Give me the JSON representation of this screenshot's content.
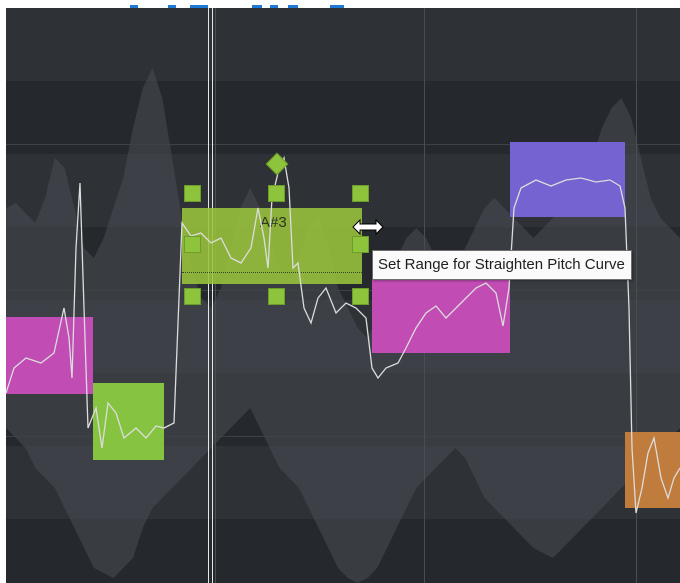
{
  "editor": {
    "background_color": "#2a2d31",
    "band_dark": "#25282c",
    "band_light": "#2e3136",
    "waveform_color": "#4b4f55",
    "pitch_curve_color": "#dcdcdc",
    "notes": [
      {
        "id": "note-1",
        "color": "#c04cb4"
      },
      {
        "id": "note-2",
        "color": "#86c341"
      },
      {
        "id": "note-selected",
        "color": "#9ac43c",
        "label": "A#3",
        "selected": true
      },
      {
        "id": "note-4",
        "color": "#c04cb4"
      },
      {
        "id": "note-5",
        "color": "#7463d0"
      },
      {
        "id": "note-6",
        "color": "#c07c3c"
      }
    ],
    "tooltip": "Set Range for Straighten Pitch Curve",
    "cursor_icon": "horizontal-resize-arrow-icon"
  },
  "header_fragment": {
    "color": "#1f7ad6"
  }
}
